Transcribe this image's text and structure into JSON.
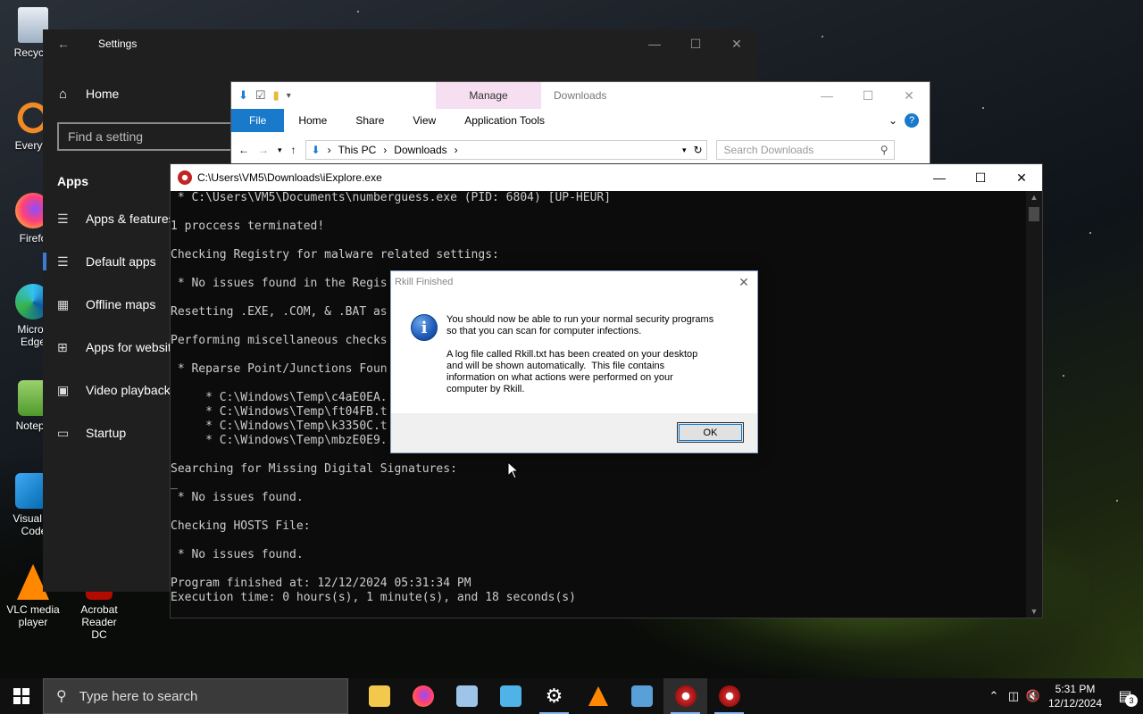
{
  "desktop": {
    "icons": [
      {
        "label": "Recycle",
        "icon": "recycle-bin-icon"
      },
      {
        "label": "Everyth",
        "icon": "everything-search-icon"
      },
      {
        "label": "Firefo",
        "icon": "firefox-icon"
      },
      {
        "label": "Micros Edge",
        "icon": "edge-icon"
      },
      {
        "label": "Notepa",
        "icon": "notepad-icon"
      },
      {
        "label": "Visual St Code",
        "icon": "vscode-icon"
      },
      {
        "label": "VLC media player",
        "icon": "vlc-icon"
      },
      {
        "label": "Acrobat Reader DC",
        "icon": "acrobat-icon"
      }
    ]
  },
  "settings": {
    "title": "Settings",
    "home": "Home",
    "search_placeholder": "Find a setting",
    "section": "Apps",
    "items": [
      {
        "label": "Apps & features",
        "icon": "list-icon"
      },
      {
        "label": "Default apps",
        "icon": "default-apps-icon"
      },
      {
        "label": "Offline maps",
        "icon": "map-icon"
      },
      {
        "label": "Apps for websites",
        "icon": "web-app-icon"
      },
      {
        "label": "Video playback",
        "icon": "video-icon"
      },
      {
        "label": "Startup",
        "icon": "startup-icon"
      }
    ]
  },
  "explorer": {
    "manage_tab": "Manage",
    "title": "Downloads",
    "ribbon_tabs": [
      "File",
      "Home",
      "Share",
      "View",
      "Application Tools"
    ],
    "breadcrumb": [
      "This PC",
      "Downloads"
    ],
    "search_placeholder": "Search Downloads"
  },
  "console": {
    "title": "C:\\Users\\VM5\\Downloads\\iExplore.exe",
    "lines": [
      " * C:\\Users\\VM5\\Documents\\numberguess.exe (PID: 6804) [UP-HEUR]",
      "",
      "1 proccess terminated!",
      "",
      "Checking Registry for malware related settings:",
      "",
      " * No issues found in the Regis",
      "",
      "Resetting .EXE, .COM, & .BAT as",
      "",
      "Performing miscellaneous checks",
      "",
      " * Reparse Point/Junctions Foun",
      "",
      "     * C:\\Windows\\Temp\\c4aE0EA.",
      "     * C:\\Windows\\Temp\\ft04FB.t",
      "     * C:\\Windows\\Temp\\k3350C.t",
      "     * C:\\Windows\\Temp\\mbzE0E9.",
      "",
      "Searching for Missing Digital Signatures:",
      "_",
      " * No issues found.",
      "",
      "Checking HOSTS File:",
      "",
      " * No issues found.",
      "",
      "Program finished at: 12/12/2024 05:31:34 PM",
      "Execution time: 0 hours(s), 1 minute(s), and 18 seconds(s)"
    ]
  },
  "dialog": {
    "title": "Rkill Finished",
    "para1": "You should now be able to run your normal security programs\nso that you can scan for computer infections.",
    "para2": "A log file called Rkill.txt has been created on your desktop\nand will be shown automatically.  This file contains\ninformation on what actions were performed on your\ncomputer by Rkill.",
    "ok_label": "OK"
  },
  "taskbar": {
    "search_placeholder": "Type here to search",
    "apps": [
      {
        "icon": "file-explorer-icon",
        "color": "#f2c94c",
        "running": false
      },
      {
        "icon": "firefox-icon",
        "color": "#ff7139",
        "running": false
      },
      {
        "icon": "network-icon",
        "color": "#9ec5e8",
        "running": false
      },
      {
        "icon": "photo-viewer-icon",
        "color": "#4fb3e8",
        "running": false
      },
      {
        "icon": "settings-gear-icon",
        "color": "#ffffff",
        "running": true
      },
      {
        "icon": "vlc-icon",
        "color": "#ff8800",
        "running": false
      },
      {
        "icon": "control-panel-icon",
        "color": "#5aa0d8",
        "running": false
      },
      {
        "icon": "rkill-icon",
        "color": "#c62828",
        "running": true
      },
      {
        "icon": "rkill-icon",
        "color": "#c62828",
        "running": true
      }
    ],
    "time": "5:31 PM",
    "date": "12/12/2024",
    "notification_count": "3"
  }
}
